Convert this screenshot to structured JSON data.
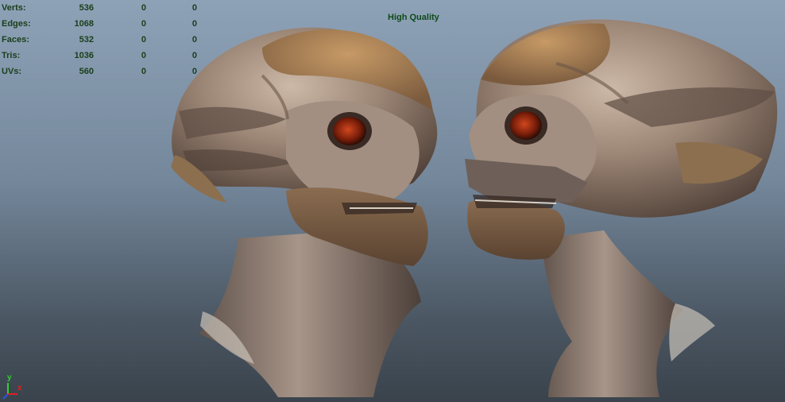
{
  "hud": {
    "rows": [
      {
        "label": "Verts:",
        "values": [
          "536",
          "0",
          "0"
        ]
      },
      {
        "label": "Edges:",
        "values": [
          "1068",
          "0",
          "0"
        ]
      },
      {
        "label": "Faces:",
        "values": [
          "532",
          "0",
          "0"
        ]
      },
      {
        "label": "Tris:",
        "values": [
          "1036",
          "0",
          "0"
        ]
      },
      {
        "label": "UVs:",
        "values": [
          "560",
          "0",
          "0"
        ]
      }
    ]
  },
  "viewport": {
    "quality_label": "High Quality",
    "axis": {
      "y": "y",
      "x": "x"
    }
  },
  "colors": {
    "hud_text": "#1a3d1a",
    "quality_text": "#0f4a1a",
    "axis_x": "#e02020",
    "axis_y": "#2fd12f",
    "axis_z": "#3050e0"
  }
}
